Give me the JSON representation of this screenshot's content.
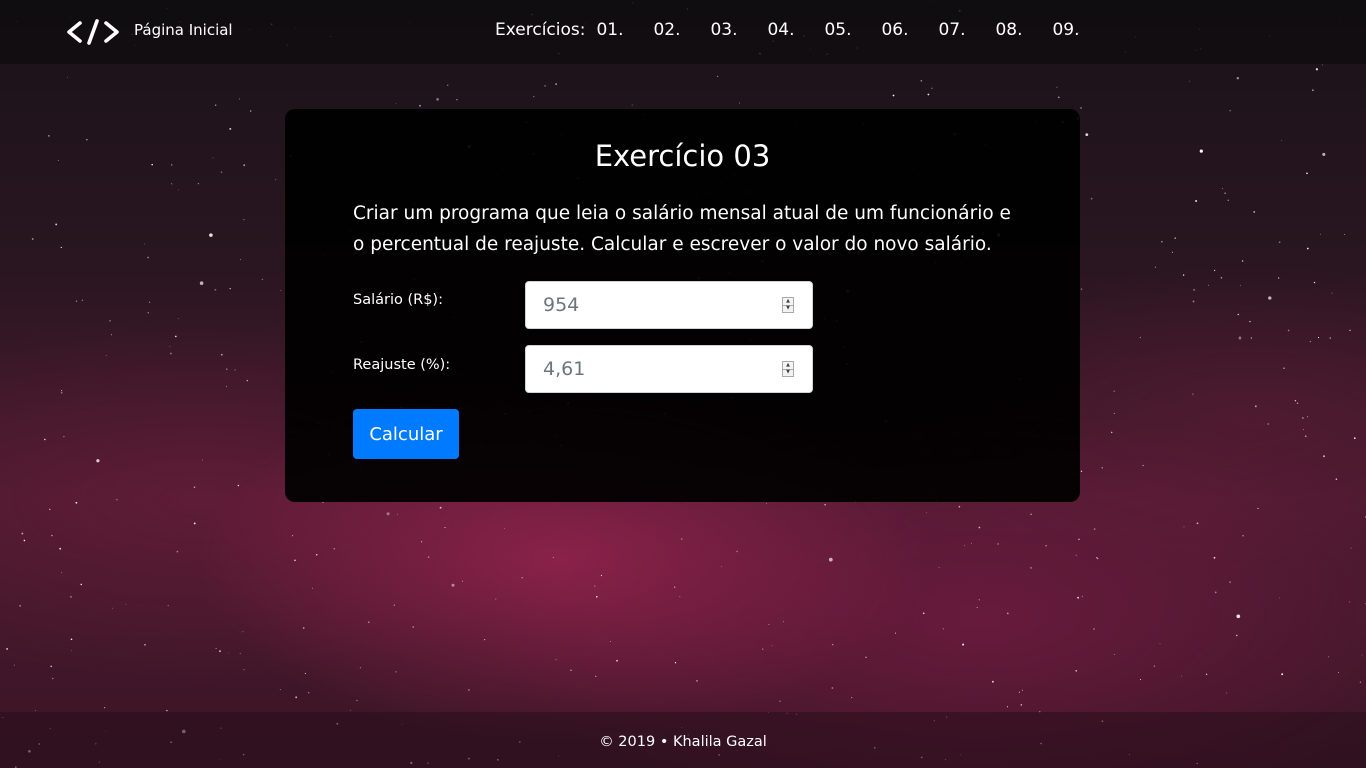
{
  "navbar": {
    "brand_icon": "code-icon",
    "home_label": "Página Inicial",
    "exercises_label": "Exercícios:",
    "exercise_links": [
      "01.",
      "02.",
      "03.",
      "04.",
      "05.",
      "06.",
      "07.",
      "08.",
      "09."
    ]
  },
  "exercise": {
    "title": "Exercício 03",
    "description": "Criar um programa que leia o salário mensal atual de um funcionário e o percentual de reajuste. Calcular e escrever o valor do novo salário.",
    "fields": [
      {
        "label": "Salário (R$):",
        "value": "954"
      },
      {
        "label": "Reajuste (%):",
        "value": "4,61"
      }
    ],
    "submit_label": "Calcular"
  },
  "footer": {
    "text": "© 2019 • Khalila Gazal"
  },
  "colors": {
    "button_primary": "#007bff",
    "card_background": "#000000",
    "text": "#ffffff"
  }
}
